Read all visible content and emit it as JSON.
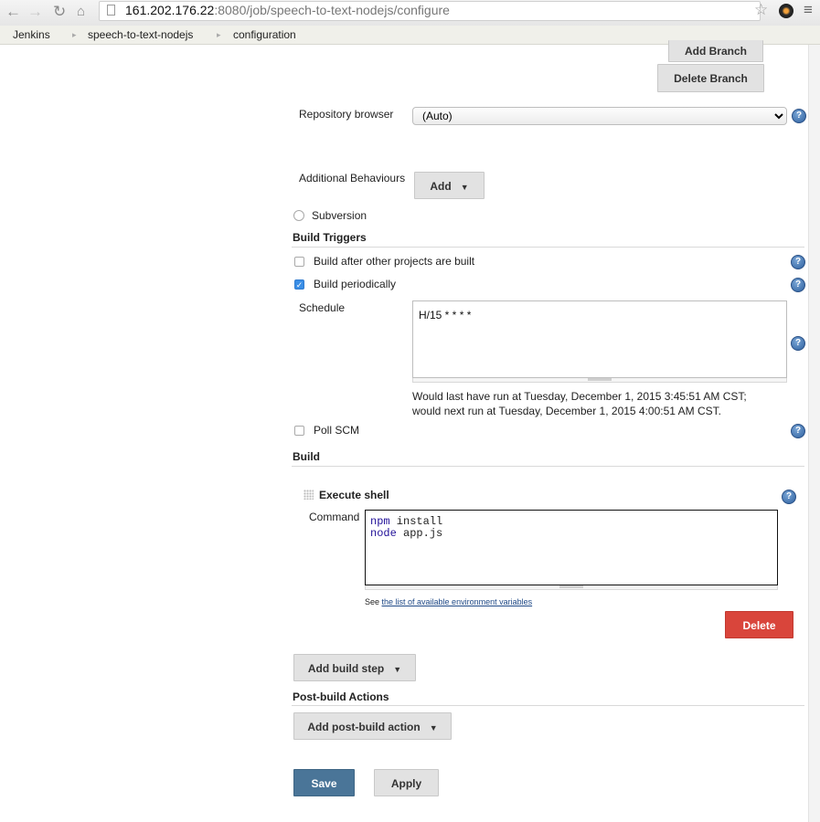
{
  "browser": {
    "url_host": "161.202.176.22",
    "url_path": ":8080/job/speech-to-text-nodejs/configure"
  },
  "breadcrumb": [
    "Jenkins",
    "speech-to-text-nodejs",
    "configuration"
  ],
  "scm": {
    "add_branch_label": "Add Branch",
    "delete_branch_label": "Delete Branch",
    "repository_browser_label": "Repository browser",
    "repository_browser_value": "(Auto)",
    "additional_behaviours_label": "Additional Behaviours",
    "add_label": "Add",
    "subversion_label": "Subversion"
  },
  "build_triggers": {
    "title": "Build Triggers",
    "after_other_projects_label": "Build after other projects are built",
    "after_other_projects_checked": false,
    "periodically_label": "Build periodically",
    "periodically_checked": true,
    "schedule_label": "Schedule",
    "schedule_value": "H/15 * * * *",
    "last_run_text": "Would last have run at Tuesday, December 1, 2015 3:45:51 AM CST;",
    "next_run_text": "would next run at Tuesday, December 1, 2015 4:00:51 AM CST.",
    "poll_scm_label": "Poll SCM",
    "poll_scm_checked": false
  },
  "build": {
    "title": "Build",
    "step_title": "Execute shell",
    "command_label": "Command",
    "command_lines": [
      {
        "keyword": "npm",
        "rest": " install"
      },
      {
        "keyword": "node",
        "rest": " app.js"
      }
    ],
    "env_prefix": "See ",
    "env_link": "the list of available environment variables",
    "delete_label": "Delete",
    "add_build_step_label": "Add build step"
  },
  "post_build": {
    "title": "Post-build Actions",
    "add_action_label": "Add post-build action"
  },
  "footer": {
    "save_label": "Save",
    "apply_label": "Apply"
  },
  "colors": {
    "delete_button": "#d9453b",
    "save_button": "#4a7598",
    "help_icon": "#2d5f9e",
    "checkbox_checked": "#3a8ee6"
  },
  "icons": {
    "back": "back-arrow-icon",
    "forward": "forward-arrow-icon",
    "reload": "reload-icon",
    "home": "home-icon",
    "page": "page-icon",
    "bookmark": "star-icon",
    "extension": "extension-icon",
    "menu": "menu-icon",
    "help": "help-icon",
    "drag": "drag-handle-icon"
  }
}
